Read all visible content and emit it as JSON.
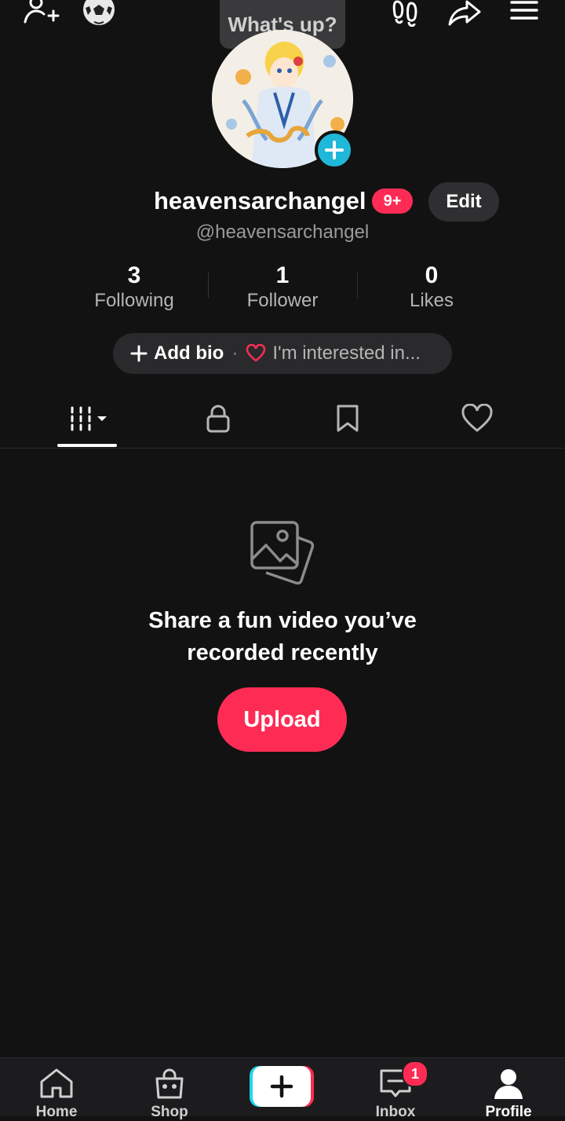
{
  "top_bar": {
    "icons": [
      "add-friend-icon",
      "soccer-ball-icon",
      "footprints-icon",
      "share-icon",
      "menu-icon"
    ],
    "status_bubble": "What's up?"
  },
  "profile": {
    "username": "heavensarchangel",
    "handle": "@heavensarchangel",
    "notification_badge": "9+",
    "edit_label": "Edit"
  },
  "stats": [
    {
      "value": "3",
      "label": "Following"
    },
    {
      "value": "1",
      "label": "Follower"
    },
    {
      "value": "0",
      "label": "Likes"
    }
  ],
  "bio": {
    "add_bio": "Add bio",
    "separator": "·",
    "interest": "I'm interested in..."
  },
  "tabs": [
    "videos-grid-icon",
    "lock-icon",
    "bookmark-icon",
    "heart-icon"
  ],
  "empty_state": {
    "line1": "Share a fun video you’ve",
    "line2": "recorded recently",
    "upload_label": "Upload"
  },
  "bottom_nav": {
    "items": [
      {
        "label": "Home",
        "icon": "home-icon"
      },
      {
        "label": "Shop",
        "icon": "shop-bag-icon"
      },
      {
        "label": "",
        "icon": "create-plus-icon"
      },
      {
        "label": "Inbox",
        "icon": "inbox-icon"
      },
      {
        "label": "Profile",
        "icon": "profile-icon"
      }
    ],
    "inbox_badge": "1"
  },
  "colors": {
    "background": "#121212",
    "accent": "#fe2c55",
    "cyan": "#20b8d8"
  }
}
